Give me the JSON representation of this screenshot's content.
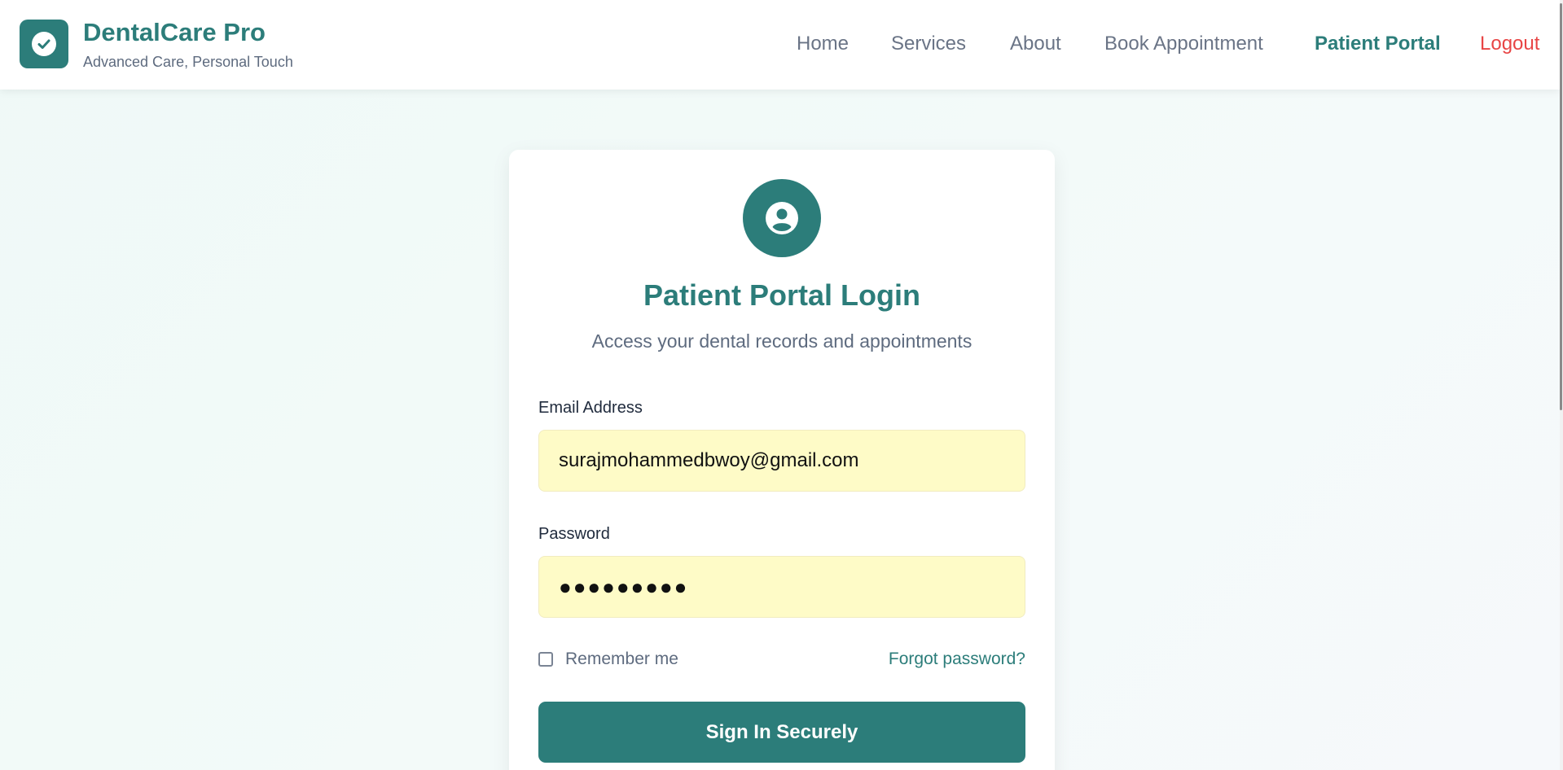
{
  "brand": {
    "name": "DentalCare Pro",
    "tagline": "Advanced Care, Personal Touch",
    "logo_icon": "check-circle-icon"
  },
  "nav": {
    "items": [
      {
        "label": "Home",
        "state": "default"
      },
      {
        "label": "Services",
        "state": "default"
      },
      {
        "label": "About",
        "state": "default"
      },
      {
        "label": "Book Appointment",
        "state": "default"
      },
      {
        "label": "Patient Portal",
        "state": "active"
      },
      {
        "label": "Logout",
        "state": "danger"
      }
    ]
  },
  "login": {
    "avatar_icon": "user-circle-icon",
    "title": "Patient Portal Login",
    "subtitle": "Access your dental records and appointments",
    "email_label": "Email Address",
    "email_value": "surajmohammedbwoy@gmail.com",
    "password_label": "Password",
    "password_masked": "●●●●●●●●●",
    "remember_label": "Remember me",
    "remember_checked": false,
    "forgot_label": "Forgot password?",
    "submit_label": "Sign In Securely"
  },
  "colors": {
    "brand": "#2c7d7a",
    "logout": "#e84545",
    "autofill_bg": "#fefbc7",
    "text_muted": "#5e6b7f"
  }
}
